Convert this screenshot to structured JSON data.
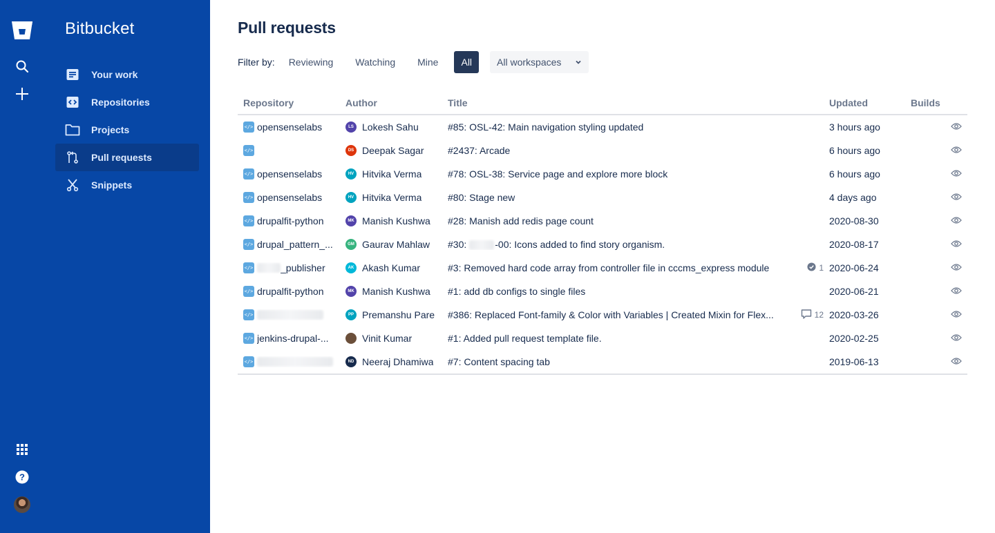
{
  "app": {
    "product_name": "Bitbucket",
    "brand_color": "#0747a6"
  },
  "rail": {
    "icons": [
      "bitbucket-logo-icon",
      "search-icon",
      "plus-icon",
      "app-switcher-icon",
      "help-icon",
      "avatar"
    ]
  },
  "sidebar": {
    "items": [
      {
        "label": "Your work",
        "icon": "your-work-icon"
      },
      {
        "label": "Repositories",
        "icon": "repositories-icon"
      },
      {
        "label": "Projects",
        "icon": "folder-icon"
      },
      {
        "label": "Pull requests",
        "icon": "pull-request-icon",
        "active": true
      },
      {
        "label": "Snippets",
        "icon": "scissors-icon"
      }
    ]
  },
  "main": {
    "title": "Pull requests",
    "filter": {
      "label": "Filter by:",
      "options": [
        "Reviewing",
        "Watching",
        "Mine",
        "All"
      ],
      "selected": "All",
      "workspace_select": "All workspaces"
    },
    "table": {
      "columns": [
        "Repository",
        "Author",
        "Title",
        "Updated",
        "Builds"
      ],
      "rows": [
        {
          "repo": "opensenselabs",
          "author": "Lokesh Sahu",
          "initials": "LS",
          "av_color": "#5243aa",
          "title": "#85: OSL-42: Main navigation styling updated",
          "updated": "3 hours ago"
        },
        {
          "repo": "",
          "repo_redacted": true,
          "author": "Deepak Sagar",
          "initials": "DS",
          "av_color": "#de350b",
          "title": "#2437: Arcade",
          "updated": "6 hours ago"
        },
        {
          "repo": "opensenselabs",
          "author": "Hitvika Verma",
          "initials": "HV",
          "av_color": "#00a3bf",
          "title": "#78: OSL-38: Service page and explore more block",
          "updated": "6 hours ago"
        },
        {
          "repo": "opensenselabs",
          "author": "Hitvika Verma",
          "initials": "HV",
          "av_color": "#00a3bf",
          "title": "#80: Stage new",
          "updated": "4 days ago"
        },
        {
          "repo": "drupalfit-python",
          "author": "Manish Kushwa",
          "initials": "MK",
          "av_color": "#5243aa",
          "title": "#28: Manish add redis page count",
          "updated": "2020-08-30"
        },
        {
          "repo": "drupal_pattern_...",
          "author": "Gaurav Mahlaw",
          "initials": "GM",
          "av_color": "#36b37e",
          "title_prefix": "#30:",
          "title": "-00: Icons added to find story organism.",
          "title_redacted": true,
          "updated": "2020-08-17"
        },
        {
          "repo": "_publisher",
          "repo_redacted_prefix": true,
          "author": "Akash Kumar",
          "initials": "AK",
          "av_color": "#00b8d9",
          "title": "#3: Removed hard code array from controller file in cccms_express module",
          "updated": "2020-06-24",
          "meta": {
            "type": "approved",
            "count": "1"
          }
        },
        {
          "repo": "drupalfit-python",
          "author": "Manish Kushwa",
          "initials": "MK",
          "av_color": "#5243aa",
          "title": "#1: add db configs to single files",
          "updated": "2020-06-21"
        },
        {
          "repo": "",
          "repo_redacted": true,
          "author": "Premanshu Pare",
          "initials": "PP",
          "av_color": "#00a3bf",
          "title": "#386: Replaced Font-family & Color with Variables | Created Mixin for Flex...",
          "updated": "2020-03-26",
          "meta": {
            "type": "comments",
            "count": "12"
          }
        },
        {
          "repo": "jenkins-drupal-...",
          "author": "Vinit Kumar",
          "initials": "",
          "av_color": "#6b4f3a",
          "title": "#1: Added pull request template file.",
          "updated": "2020-02-25"
        },
        {
          "repo": "",
          "repo_redacted": true,
          "author": "Neeraj Dhamiwa",
          "initials": "ND",
          "av_color": "#172b4d",
          "title": "#7: Content spacing tab",
          "updated": "2019-06-13"
        }
      ]
    }
  }
}
